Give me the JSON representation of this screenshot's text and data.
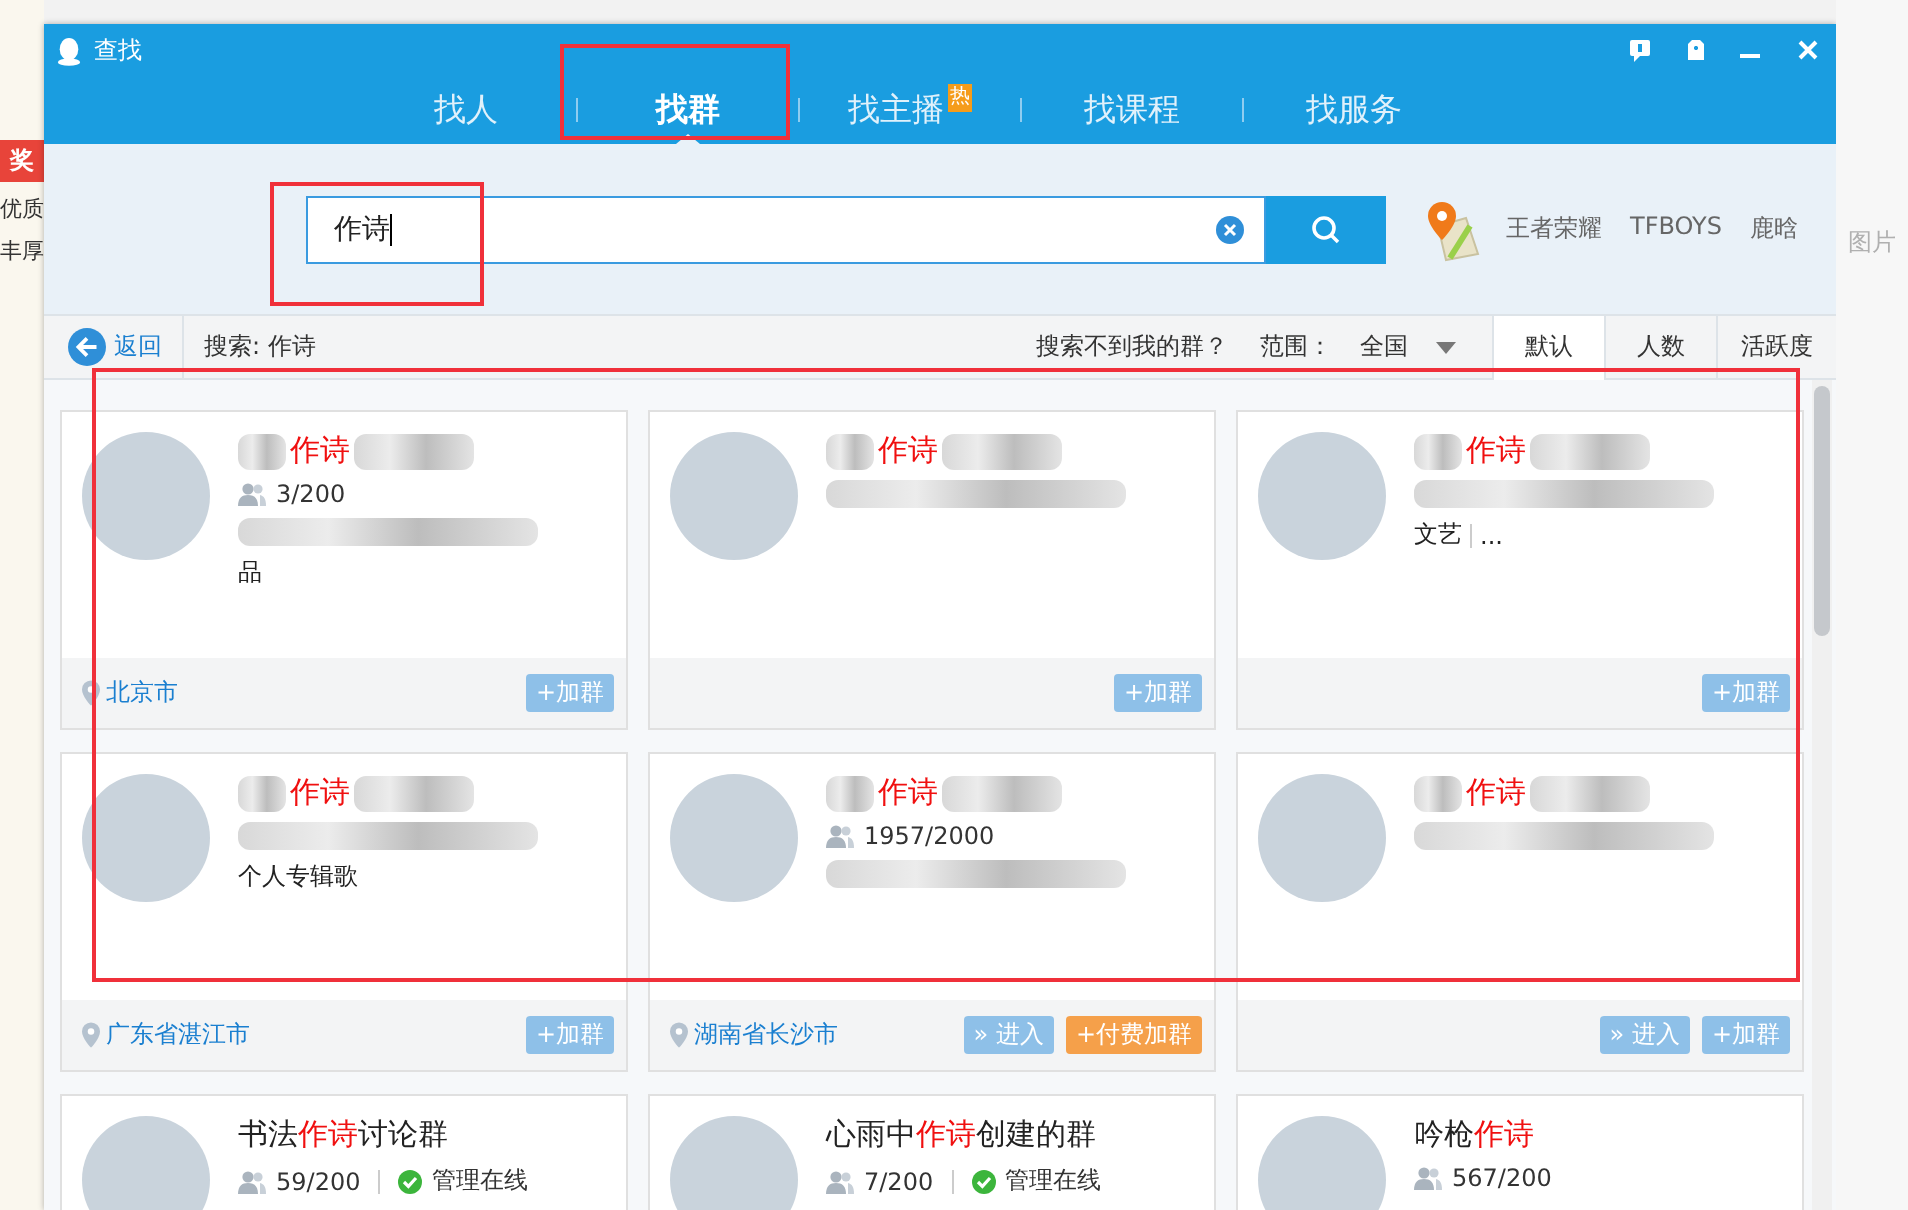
{
  "background_page": {
    "badge": "奖",
    "lines": [
      "优质",
      "丰厚"
    ],
    "right_text": "图片"
  },
  "window": {
    "title": "查找"
  },
  "window_controls": [
    {
      "kind": "feedback"
    },
    {
      "kind": "skin"
    },
    {
      "kind": "minimize"
    },
    {
      "kind": "close"
    }
  ],
  "tabs": [
    {
      "label": "找人",
      "selected": false
    },
    {
      "label": "找群",
      "selected": true
    },
    {
      "label": "找主播",
      "selected": false,
      "badge": "热"
    },
    {
      "label": "找课程",
      "selected": false
    },
    {
      "label": "找服务",
      "selected": false
    }
  ],
  "search": {
    "value": "作诗"
  },
  "hot_keywords": [
    "王者荣耀",
    "TFBOYS",
    "鹿晗"
  ],
  "toolbar": {
    "back": "返回",
    "query": "搜索: 作诗",
    "help_link": "搜索不到我的群？",
    "scope_label": "范围：",
    "scope_value": "全国",
    "sort_tabs": [
      {
        "label": "默认",
        "selected": true
      },
      {
        "label": "人数",
        "selected": false
      },
      {
        "label": "活跃度",
        "selected": false
      }
    ]
  },
  "results": [
    {
      "title": [
        {
          "text": "作诗",
          "match": true
        }
      ],
      "members": "3/200",
      "tags": [
        "品"
      ],
      "location": "北京市",
      "actions": [
        {
          "kind": "join",
          "label": "+加群"
        }
      ],
      "blurred": true
    },
    {
      "title": [
        {
          "text": "作诗",
          "match": true
        }
      ],
      "actions": [
        {
          "kind": "join",
          "label": "+加群"
        }
      ],
      "blurred": true
    },
    {
      "title": [
        {
          "text": "作诗",
          "match": true
        }
      ],
      "tags": [
        "文艺",
        "..."
      ],
      "actions": [
        {
          "kind": "join",
          "label": "+加群"
        }
      ],
      "blurred": true
    },
    {
      "title": [
        {
          "text": "作诗",
          "match": true
        }
      ],
      "tags": [
        "个人专辑歌"
      ],
      "location": "广东省湛江市",
      "actions": [
        {
          "kind": "join",
          "label": "+加群"
        }
      ],
      "blurred": true
    },
    {
      "title": [
        {
          "text": "作诗",
          "match": true
        }
      ],
      "members": "1957/2000",
      "location": "湖南省长沙市",
      "actions": [
        {
          "kind": "enter",
          "label": "» 进入"
        },
        {
          "kind": "paid",
          "label": "+付费加群"
        }
      ],
      "blurred": true
    },
    {
      "title": [
        {
          "text": "作诗",
          "match": true
        }
      ],
      "actions": [
        {
          "kind": "enter",
          "label": "» 进入"
        },
        {
          "kind": "join",
          "label": "+加群"
        }
      ],
      "blurred": true
    },
    {
      "title": [
        {
          "text": "书法",
          "match": false
        },
        {
          "text": "作诗",
          "match": true
        },
        {
          "text": "讨论群",
          "match": false
        }
      ],
      "members": "59/200",
      "admin": "管理在线",
      "blurred": false
    },
    {
      "title": [
        {
          "text": "心雨中",
          "match": false
        },
        {
          "text": "作诗",
          "match": true
        },
        {
          "text": "创建的群",
          "match": false
        }
      ],
      "members": "7/200",
      "admin": "管理在线",
      "blurred": false
    },
    {
      "title": [
        {
          "text": "吟枪",
          "match": false
        },
        {
          "text": "作诗",
          "match": true
        }
      ],
      "members": "567/200",
      "blurred": false
    }
  ],
  "annotations": [
    {
      "kind": "tab"
    },
    {
      "kind": "search"
    },
    {
      "kind": "results"
    }
  ]
}
